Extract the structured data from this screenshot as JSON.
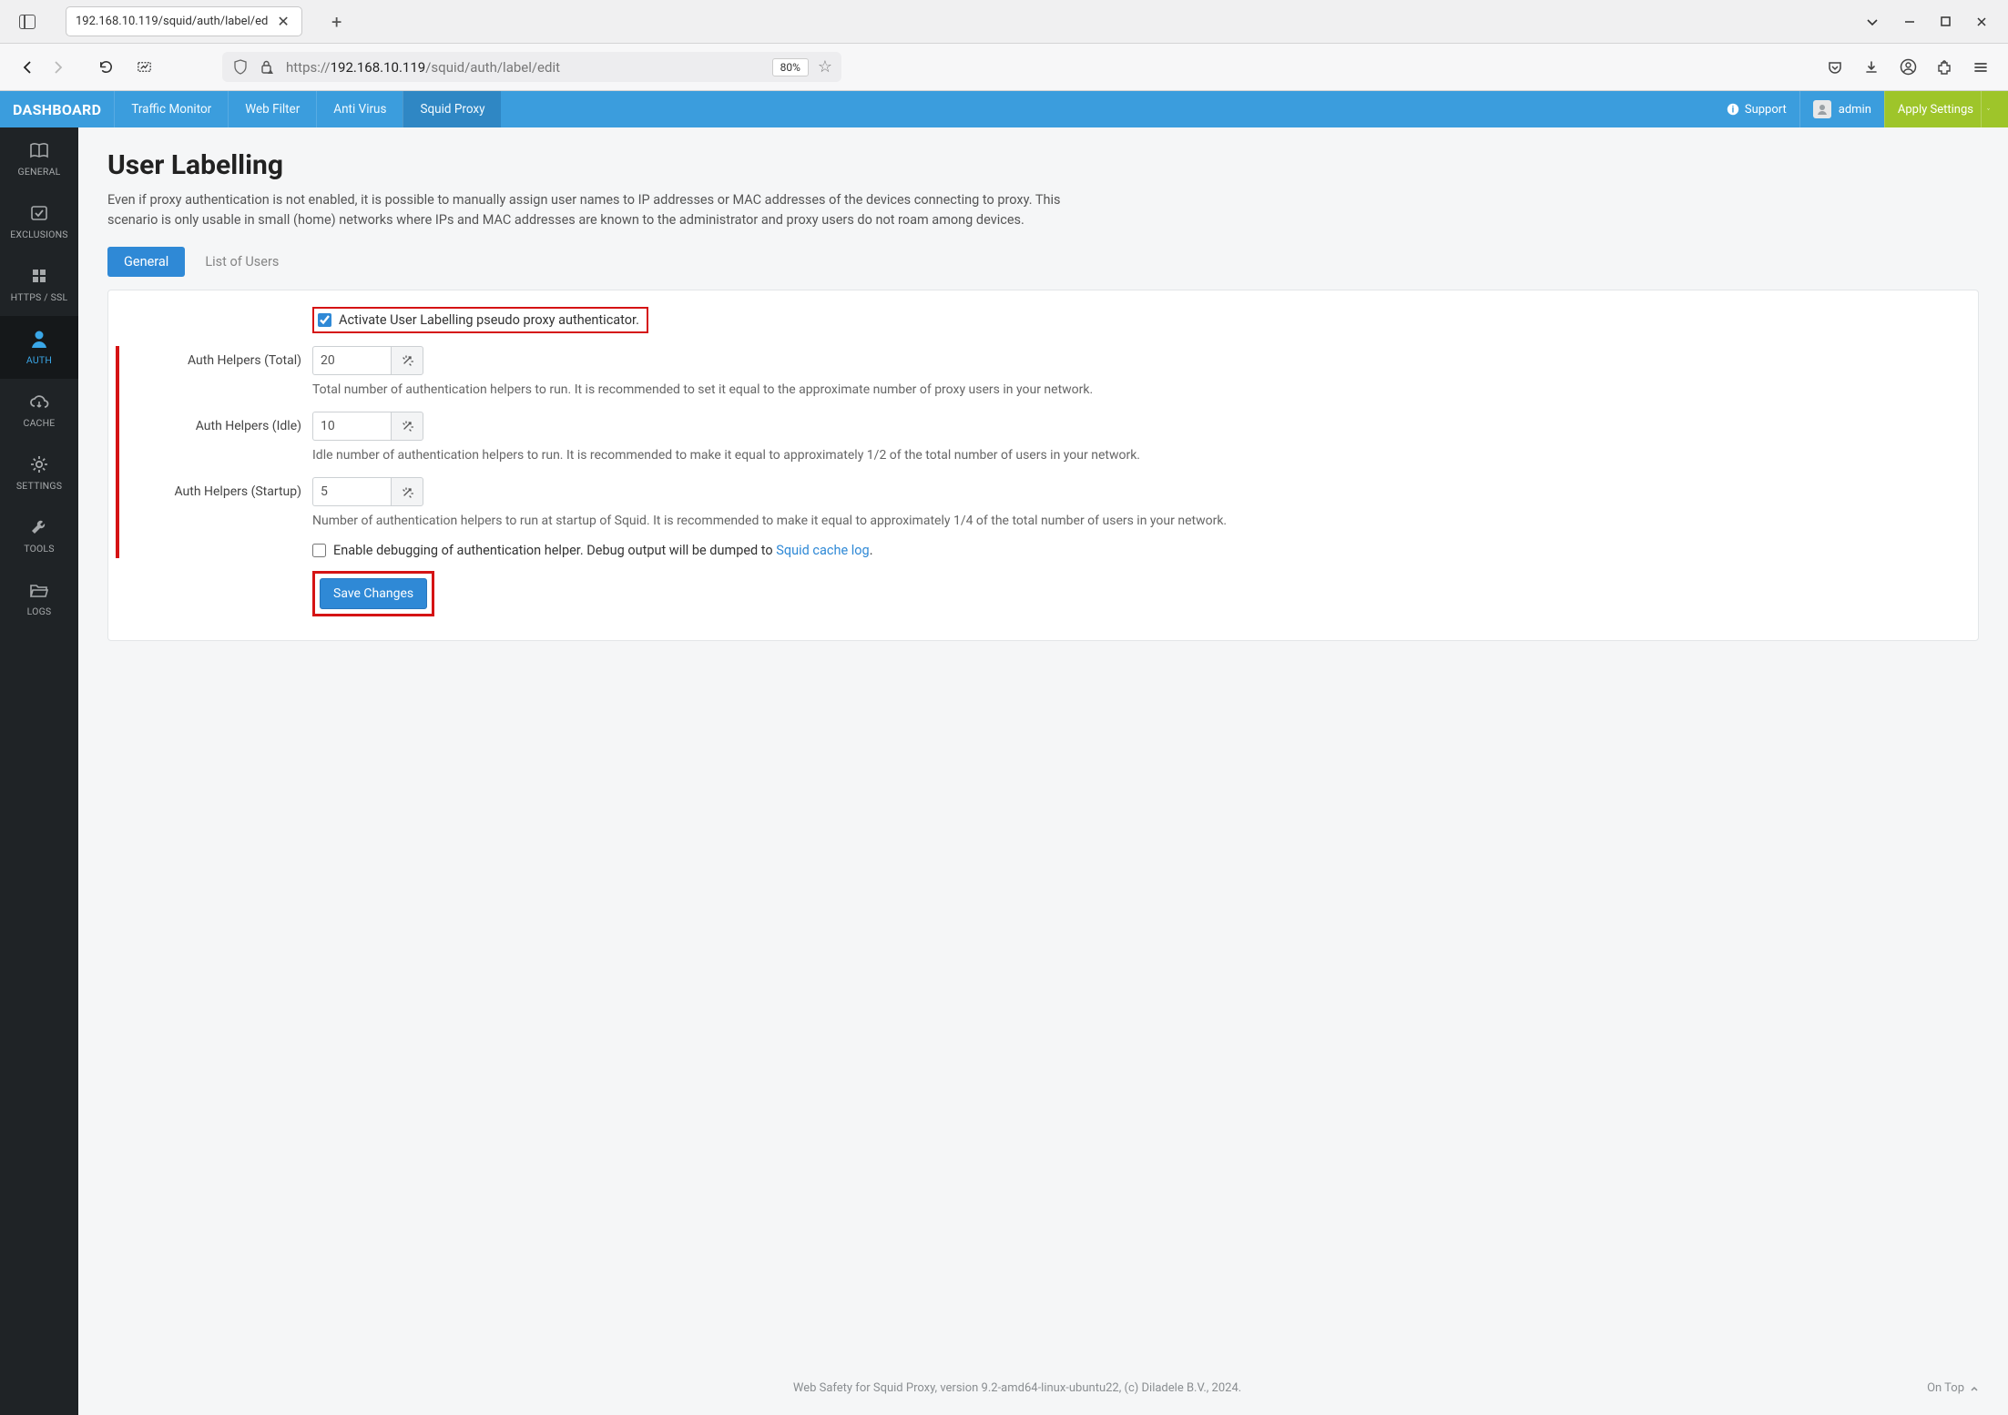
{
  "browser": {
    "tab_label": "192.168.10.119/squid/auth/label/ed",
    "url_proto": "https://",
    "url_host": "192.168.10.119",
    "url_path": "/squid/auth/label/edit",
    "zoom": "80%"
  },
  "header": {
    "brand": "DASHBOARD",
    "nav": [
      "Traffic Monitor",
      "Web Filter",
      "Anti Virus",
      "Squid Proxy"
    ],
    "active_nav": 3,
    "support": "Support",
    "user": "admin",
    "apply": "Apply Settings"
  },
  "sidebar": {
    "items": [
      {
        "label": "GENERAL",
        "icon": "book"
      },
      {
        "label": "EXCLUSIONS",
        "icon": "check-square"
      },
      {
        "label": "HTTPS / SSL",
        "icon": "grid"
      },
      {
        "label": "AUTH",
        "icon": "user"
      },
      {
        "label": "CACHE",
        "icon": "cloud"
      },
      {
        "label": "SETTINGS",
        "icon": "gear"
      },
      {
        "label": "TOOLS",
        "icon": "wrench"
      },
      {
        "label": "LOGS",
        "icon": "folder"
      }
    ],
    "active": 3
  },
  "page": {
    "title": "User Labelling",
    "lead": "Even if proxy authentication is not enabled, it is possible to manually assign user names to IP addresses or MAC addresses of the devices connecting to proxy. This scenario is only usable in small (home) networks where IPs and MAC addresses are known to the administrator and proxy users do not roam among devices.",
    "tabs": [
      "General",
      "List of Users"
    ],
    "active_tab": 0
  },
  "form": {
    "activate_label": "Activate User Labelling pseudo proxy authenticator.",
    "activate_checked": true,
    "total": {
      "label": "Auth Helpers (Total)",
      "value": "20",
      "help": "Total number of authentication helpers to run. It is recommended to set it equal to the approximate number of proxy users in your network."
    },
    "idle": {
      "label": "Auth Helpers (Idle)",
      "value": "10",
      "help": "Idle number of authentication helpers to run. It is recommended to make it equal to approximately 1/2 of the total number of users in your network."
    },
    "startup": {
      "label": "Auth Helpers (Startup)",
      "value": "5",
      "help": "Number of authentication helpers to run at startup of Squid. It is recommended to make it equal to approximately 1/4 of the total number of users in your network."
    },
    "debug_prefix": "Enable debugging of authentication helper. Debug output will be dumped to ",
    "debug_link": "Squid cache log",
    "debug_checked": false,
    "save": "Save Changes"
  },
  "footer": {
    "text": "Web Safety for Squid Proxy, version 9.2-amd64-linux-ubuntu22, (c) Diladele B.V., 2024.",
    "ontop": "On Top"
  }
}
